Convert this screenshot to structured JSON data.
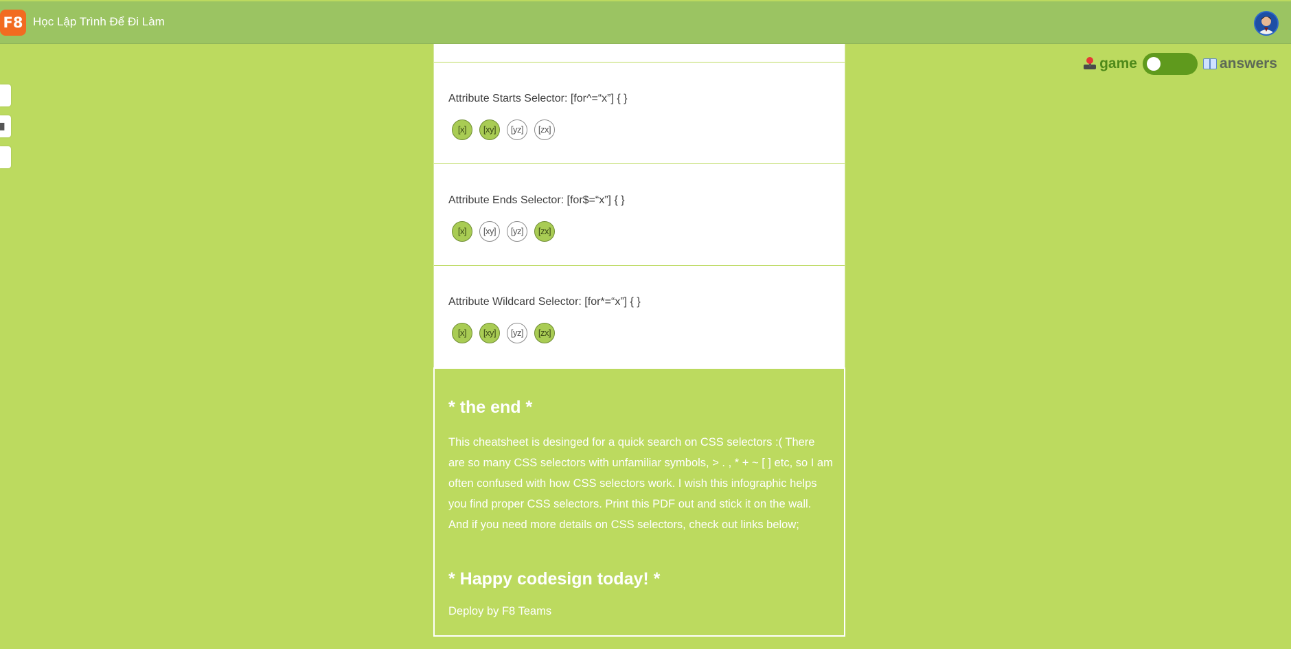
{
  "header": {
    "logo": "F8",
    "title": "Học Lập Trình Để Đi Làm"
  },
  "mode_toggle": {
    "game_label": "game",
    "answers_label": "answers",
    "game_icon": "joystick-icon",
    "answers_icon": "open-book-icon",
    "active": "game"
  },
  "side_tabs": [
    "",
    "",
    ""
  ],
  "sections": [
    {
      "label": "Attribute Starts Selector: [for^=“x”] { }",
      "chips": [
        {
          "text": "[x]",
          "active": true
        },
        {
          "text": "[xy]",
          "active": true
        },
        {
          "text": "[yz]",
          "active": false
        },
        {
          "text": "[zx]",
          "active": false
        }
      ]
    },
    {
      "label": "Attribute Ends Selector: [for$=“x”] { }",
      "chips": [
        {
          "text": "[x]",
          "active": true
        },
        {
          "text": "[xy]",
          "active": false
        },
        {
          "text": "[yz]",
          "active": false
        },
        {
          "text": "[zx]",
          "active": true
        }
      ]
    },
    {
      "label": "Attribute Wildcard Selector: [for*=“x”] { }",
      "chips": [
        {
          "text": "[x]",
          "active": true
        },
        {
          "text": "[xy]",
          "active": true
        },
        {
          "text": "[yz]",
          "active": false
        },
        {
          "text": "[zx]",
          "active": true
        }
      ]
    }
  ],
  "end": {
    "title": "* the end *",
    "text": "This cheatsheet is desinged for a quick search on CSS selectors :( There are so many CSS selectors with unfamiliar symbols, > . , * + ~ [ ] etc, so I am often confused with how CSS selectors work. I wish this infographic helps you find proper CSS selectors. Print this PDF out and stick it on the wall. And if you need more details on CSS selectors, check out links below;",
    "happy": "* Happy codesign today! *",
    "deploy": "Deploy by F8 Teams"
  },
  "colors": {
    "background": "#bcda5f",
    "header": "#9bc462",
    "logo": "#f26b21",
    "chip_active": "#a9cc54",
    "switch": "#5f9a1d"
  }
}
